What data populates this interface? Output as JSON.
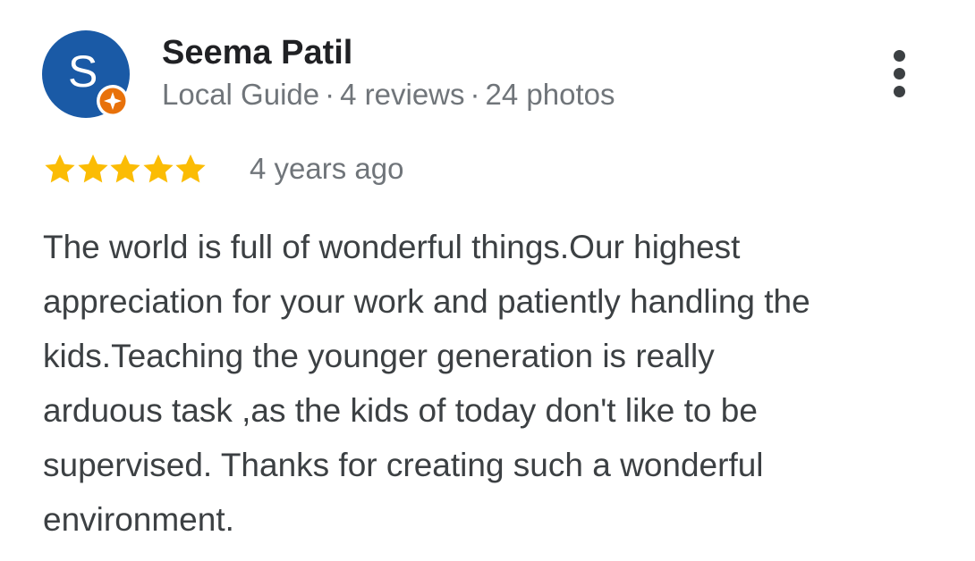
{
  "review": {
    "author": {
      "initial": "S",
      "name": "Seema Patil",
      "badge_icon": "local-guide-star-icon",
      "meta": {
        "role": "Local Guide",
        "separator": "·",
        "reviews": "4 reviews",
        "photos": "24 photos"
      }
    },
    "menu_icon": "more-vert-icon",
    "rating": {
      "stars": 5,
      "max": 5,
      "star_color": "#fbbc04"
    },
    "time_ago": "4 years ago",
    "text_lines": [
      "The world is full of wonderful things.Our highest",
      "appreciation for your work and patiently handling the",
      "kids.Teaching the younger generation is really",
      "arduous task ,as the kids of today don't like to be",
      "supervised. Thanks for creating such a wonderful",
      "environment."
    ]
  },
  "colors": {
    "avatar_bg": "#1a5aa6",
    "badge": "#e8710a",
    "name": "#202124",
    "meta": "#70757a",
    "body": "#3c4043"
  }
}
